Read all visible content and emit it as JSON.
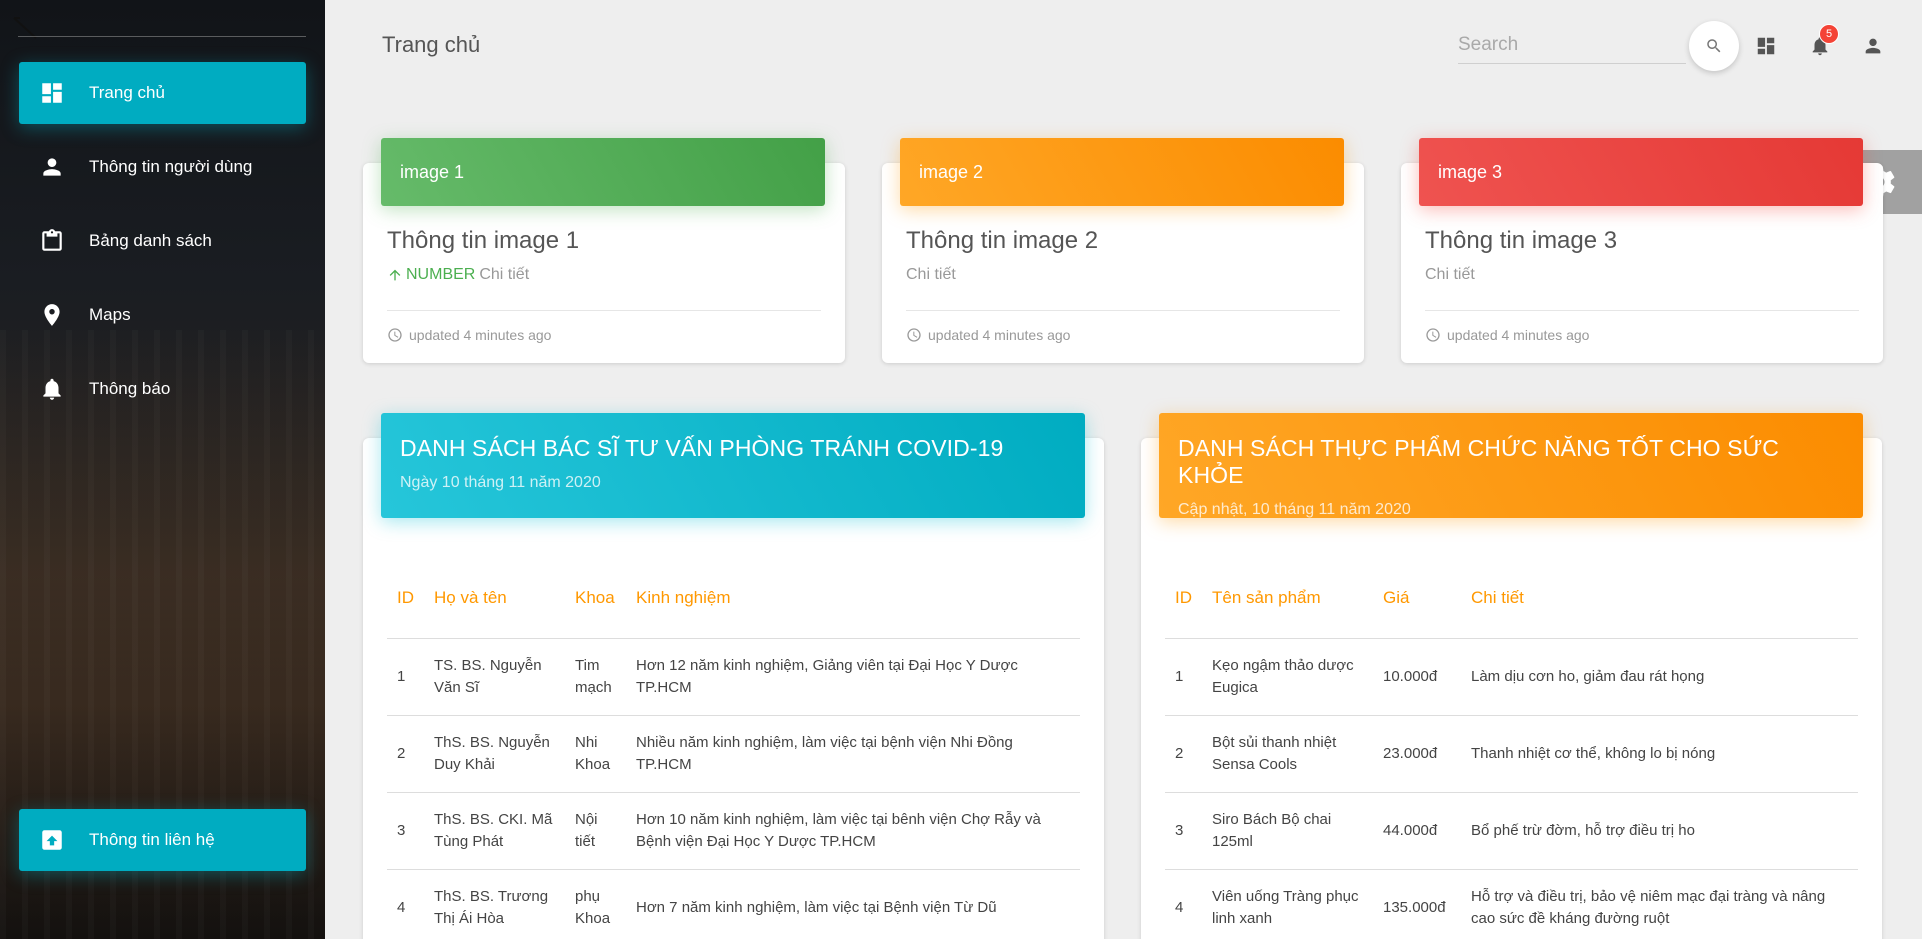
{
  "sidebar": {
    "items": [
      {
        "label": "Trang chủ",
        "icon": "dashboard-icon",
        "active": true
      },
      {
        "label": "Thông tin người dùng",
        "icon": "person-icon",
        "active": false
      },
      {
        "label": "Bảng danh sách",
        "icon": "clipboard-icon",
        "active": false
      },
      {
        "label": "Maps",
        "icon": "location-pin-icon",
        "active": false
      },
      {
        "label": "Thông báo",
        "icon": "bell-icon",
        "active": false
      }
    ],
    "bottom": {
      "label": "Thông tin liên hệ",
      "icon": "upgrade-icon"
    }
  },
  "header": {
    "title": "Trang chủ",
    "search_placeholder": "Search",
    "notification_count": "5"
  },
  "stats": [
    {
      "head": "image 1",
      "title": "Thông tin image 1",
      "highlight": "NUMBER",
      "detail": "Chi tiết",
      "footer": "updated 4 minutes ago",
      "color": "#4caf50"
    },
    {
      "head": "image 2",
      "title": "Thông tin image 2",
      "detail": "Chi tiết",
      "footer": "updated 4 minutes ago",
      "color": "#ff9800"
    },
    {
      "head": "image 3",
      "title": "Thông tin image 3",
      "detail": "Chi tiết",
      "footer": "updated 4 minutes ago",
      "color": "#f44336"
    }
  ],
  "doctors": {
    "title": "DANH SÁCH BÁC SĨ TƯ VẤN PHÒNG TRÁNH COVID-19",
    "subtitle": "Ngày 10 tháng 11 năm 2020",
    "columns": [
      "ID",
      "Họ và tên",
      "Khoa",
      "Kinh nghiệm"
    ],
    "rows": [
      [
        "1",
        "TS. BS. Nguyễn Văn Sĩ",
        "Tim mạch",
        "Hơn 12 năm kinh nghiệm, Giảng viên tại Đại Học Y Dược TP.HCM"
      ],
      [
        "2",
        "ThS. BS. Nguyễn Duy Khải",
        "Nhi Khoa",
        "Nhiều năm kinh nghiệm, làm việc tại bệnh viện Nhi Đồng TP.HCM"
      ],
      [
        "3",
        "ThS. BS. CKI. Mã Tùng Phát",
        "Nội tiết",
        "Hơn 10 năm kinh nghiệm, làm việc tại bênh viện Chợ Rẫy và Bệnh viện Đại Học Y Dược TP.HCM"
      ],
      [
        "4",
        "ThS. BS. Trương Thị Ái Hòa",
        "phụ Khoa",
        "Hơn 7 năm kinh nghiệm, làm việc tại Bệnh viện Từ Dũ"
      ]
    ]
  },
  "products": {
    "title": "DANH SÁCH THỰC PHẨM CHỨC NĂNG TỐT CHO SỨC KHỎE",
    "subtitle": "Cập nhật, 10 tháng 11 năm 2020",
    "columns": [
      "ID",
      "Tên sản phẩm",
      "Giá",
      "Chi tiết"
    ],
    "rows": [
      [
        "1",
        "Kẹo ngậm thảo dược Eugica",
        "10.000đ",
        "Làm dịu cơn ho, giảm đau rát họng"
      ],
      [
        "2",
        "Bột sủi thanh nhiệt Sensa Cools",
        "23.000đ",
        "Thanh nhiệt cơ thể, không lo bị nóng"
      ],
      [
        "3",
        "Siro Bách Bộ chai 125ml",
        "44.000đ",
        "Bổ phế trừ đờm, hỗ trợ điều trị ho"
      ],
      [
        "4",
        "Viên uống Tràng phục linh xanh",
        "135.000đ",
        "Hỗ trợ và điều trị, bảo vệ niêm mạc đại tràng và nâng cao sức đề kháng đường ruột"
      ]
    ]
  }
}
